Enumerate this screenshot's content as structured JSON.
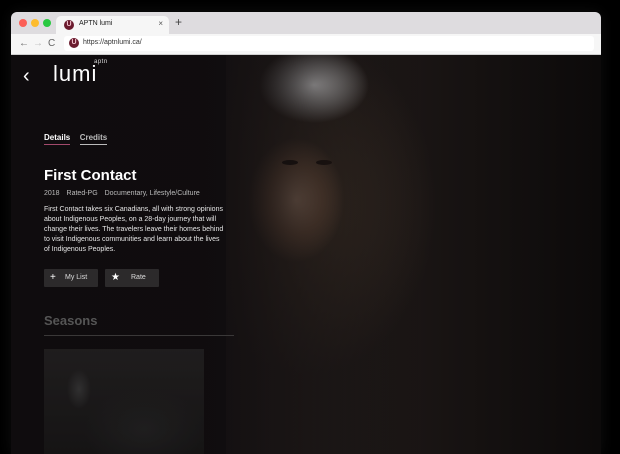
{
  "browser": {
    "tab_title": "APTN lumi",
    "tab_close": "×",
    "new_tab": "+",
    "url": "https://aptnlumi.ca/",
    "favicon_letter": "U"
  },
  "nav": {
    "back": "←",
    "forward": "→",
    "reload": "C"
  },
  "header": {
    "back_icon": "‹",
    "logo_small": "aptn",
    "logo_main": "lumi"
  },
  "detail_tabs": [
    {
      "label": "Details",
      "active": true
    },
    {
      "label": "Credits",
      "active": false
    }
  ],
  "show": {
    "title": "First Contact",
    "year": "2018",
    "rating": "Rated-PG",
    "genres": "Documentary, Lifestyle/Culture",
    "description": "First Contact takes six Canadians, all with strong opinions about Indigenous Peoples, on a 28-day journey that will change their lives. The travelers leave their homes behind to visit Indigenous communities and learn about the lives of Indigenous Peoples."
  },
  "actions": {
    "my_list_icon": "+",
    "my_list": "My List",
    "rate_icon": "★",
    "rate": "Rate"
  },
  "seasons": {
    "heading": "Seasons"
  },
  "colors": {
    "accent": "#a34a6c",
    "background": "#141113"
  }
}
